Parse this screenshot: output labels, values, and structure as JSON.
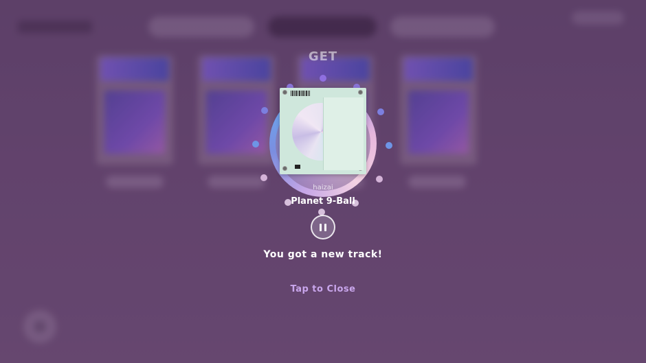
{
  "modal": {
    "header": "GET",
    "artist": "haizai",
    "track_title": "Planet 9-Ball",
    "message": "You got a new track!",
    "close_label": "Tap to Close",
    "playback_state": "playing",
    "pause_icon": "pause-icon"
  },
  "colors": {
    "accent": "#c9a6ec",
    "background": "#64436c",
    "ring_blue": "#6aa8ee",
    "ring_pink": "#f3d2e3"
  }
}
